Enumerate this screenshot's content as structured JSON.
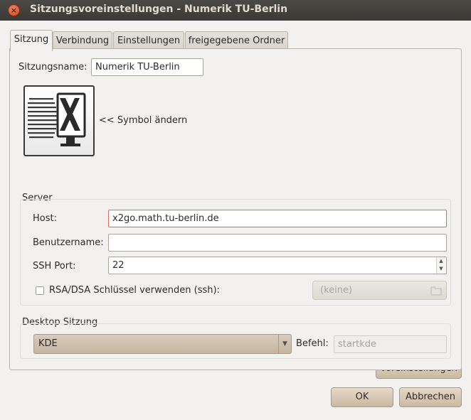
{
  "window": {
    "title": "Sitzungsvoreinstellungen - Numerik TU-Berlin",
    "close_glyph": "×"
  },
  "tabs": [
    {
      "label": "Sitzung",
      "active": true
    },
    {
      "label": "Verbindung",
      "active": false
    },
    {
      "label": "Einstellungen",
      "active": false
    },
    {
      "label": "freigegebene Ordner",
      "active": false
    }
  ],
  "session": {
    "name_label": "Sitzungsname:",
    "name_value": "Numerik TU-Berlin",
    "icon": "x2go-session-icon",
    "change_icon_label": "<< Symbol ändern"
  },
  "server": {
    "title": "Server",
    "host_label": "Host:",
    "host_value": "x2go.math.tu-berlin.de",
    "user_label": "Benutzername:",
    "user_value": "",
    "port_label": "SSH Port:",
    "port_value": "22",
    "key_label": "RSA/DSA Schlüssel verwenden (ssh):",
    "key_checked": false,
    "key_file": "(keine)"
  },
  "desktop": {
    "title": "Desktop Sitzung",
    "session_type": "KDE",
    "command_label": "Befehl:",
    "command_value": "startkde"
  },
  "buttons": {
    "defaults": "Voreinstellungen",
    "ok": "OK",
    "cancel": "Abbrechen"
  },
  "colors": {
    "titlebar": "#3c3b37",
    "focus_border": "#d96b5a",
    "button": "#d8ccbb"
  }
}
